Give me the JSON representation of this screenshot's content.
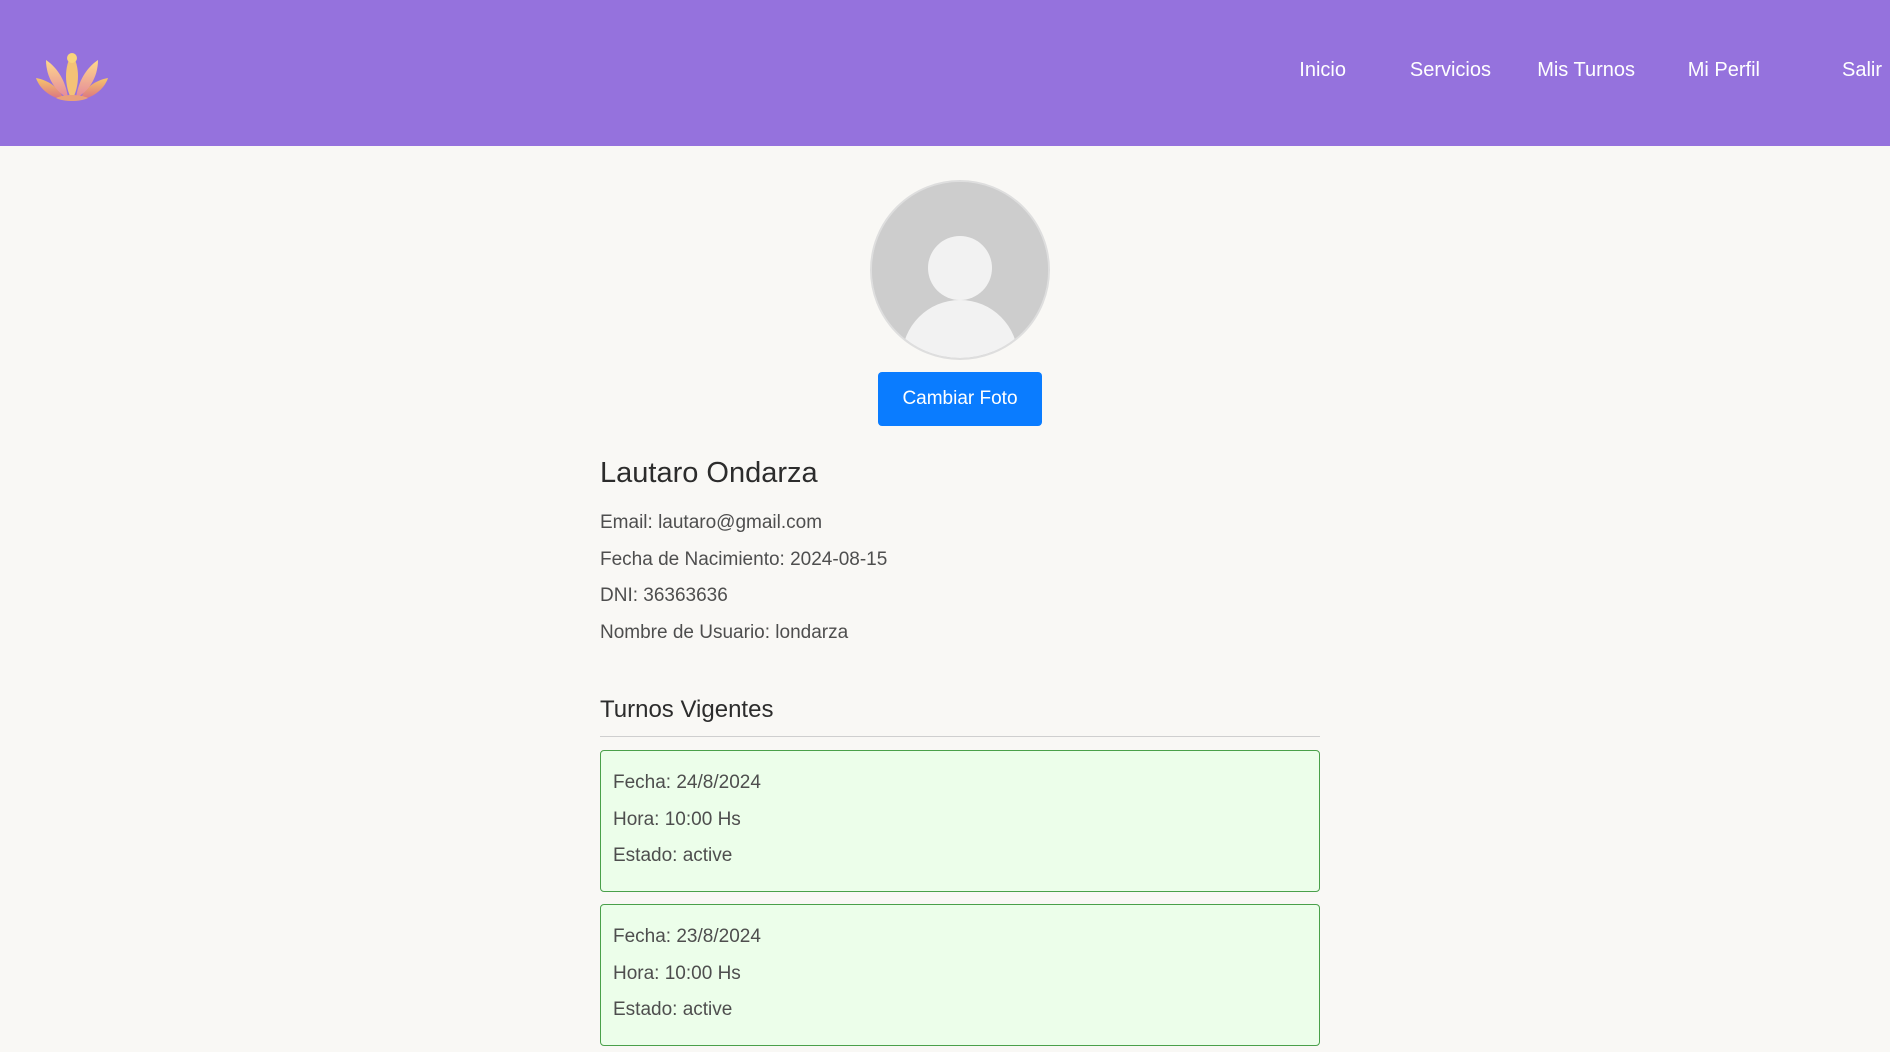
{
  "colors": {
    "navbar": "#9572dd",
    "primary_button": "#0a7cff",
    "appointment_bg": "#ecfeea",
    "appointment_border": "#4aa04a",
    "page_bg": "#f9f8f5"
  },
  "header": {
    "logo_icon": "lotus-logo-icon",
    "nav": [
      {
        "label": "Inicio"
      },
      {
        "label": "Servicios"
      },
      {
        "label": "Mis Turnos"
      },
      {
        "label": "Mi Perfil"
      },
      {
        "label": "Salir"
      }
    ]
  },
  "profile": {
    "avatar_icon": "default-user-avatar-icon",
    "change_photo_label": "Cambiar Foto",
    "name": "Lautaro Ondarza",
    "details": [
      {
        "text": "Email: lautaro@gmail.com"
      },
      {
        "text": "Fecha de Nacimiento: 2024-08-15"
      },
      {
        "text": "DNI: 36363636"
      },
      {
        "text": "Nombre de Usuario: londarza"
      }
    ]
  },
  "appointments": {
    "title": "Turnos Vigentes",
    "items": [
      {
        "fecha": "Fecha: 24/8/2024",
        "hora": "Hora: 10:00 Hs",
        "estado": "Estado: active"
      },
      {
        "fecha": "Fecha: 23/8/2024",
        "hora": "Hora: 10:00 Hs",
        "estado": "Estado: active"
      }
    ]
  }
}
